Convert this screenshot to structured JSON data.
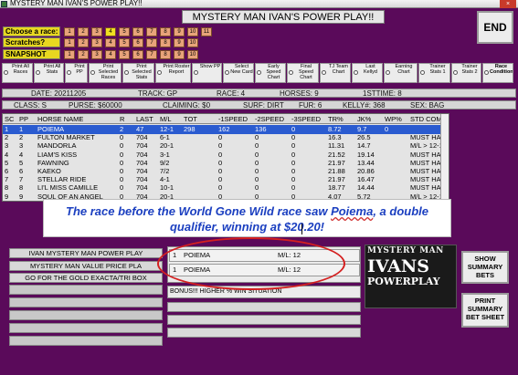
{
  "window": {
    "title": "MYSTERY MAN IVAN'S POWER PLAY!!",
    "close_label": "×"
  },
  "banner": "MYSTERY MAN IVAN'S POWER PLAY!!",
  "end_label": "END",
  "choose_race": {
    "label": "Choose a race:",
    "numbers": [
      "1",
      "2",
      "3",
      "4",
      "5",
      "6",
      "7",
      "8",
      "9",
      "10",
      "11"
    ],
    "selected": "4"
  },
  "scratches": {
    "label": "Scratches?",
    "numbers": [
      "1",
      "2",
      "3",
      "4",
      "5",
      "6",
      "7",
      "8",
      "9",
      "10"
    ]
  },
  "snapshot": {
    "label": "SNAPSHOT",
    "numbers": [
      "1",
      "2",
      "3",
      "4",
      "5",
      "6",
      "7",
      "8",
      "9",
      "10"
    ]
  },
  "options": [
    "Print All Races",
    "Print All Stats",
    "Print PP",
    "Print Selected Races",
    "Print Selected Stats",
    "Print Roster Report",
    "Show PP",
    "Select New Card",
    "Early Speed Chart",
    "Final Speed Chart",
    "TJ Team Chart",
    "Last Kellyd",
    "Earning Chart",
    "Trainer Stats 1",
    "Trainer Stats 2",
    "Race Conditions"
  ],
  "race_info": {
    "date": "DATE: 20211205",
    "track": "TRACK: GP",
    "race": "RACE: 4",
    "horses": "HORSES: 9",
    "istime": "1STTIME: 8"
  },
  "class_info": {
    "class": "CLASS: S",
    "purse": "PURSE: $60000",
    "claiming": "CLAIMING: $0",
    "surf": "SURF: DIRT",
    "fur": "FUR: 6",
    "kelly": "KELLY#: 368",
    "sex": "SEX: BAG"
  },
  "grid": {
    "headers": [
      "SC",
      "PP",
      "HORSE NAME",
      "R",
      "LAST",
      "M/L",
      "TOT",
      "-1SPEED",
      "-2SPEED",
      "-3SPEED",
      "TR%",
      "JK%",
      "WP%",
      "STD COMMENTS"
    ],
    "rows": [
      {
        "sc": "1",
        "pp": "1",
        "name": "POIEMA",
        "r": "2",
        "last": "47",
        "ml": "12-1",
        "tot": "298",
        "s1": "162",
        "s2": "136",
        "s3": "0",
        "tr": "8.72",
        "jk": "9.7",
        "wp": "0",
        "cm": ""
      },
      {
        "sc": "2",
        "pp": "2",
        "name": "FULTON MARKET",
        "r": "0",
        "last": "704",
        "ml": "6-1",
        "tot": "",
        "s1": "0",
        "s2": "0",
        "s3": "0",
        "tr": "16.3",
        "jk": "26.5",
        "wp": "",
        "cm": "MUST HAVE >= 1 PPs..."
      },
      {
        "sc": "3",
        "pp": "3",
        "name": "MANDORLA",
        "r": "0",
        "last": "704",
        "ml": "20-1",
        "tot": "",
        "s1": "0",
        "s2": "0",
        "s3": "0",
        "tr": "11.31",
        "jk": "14.7",
        "wp": "",
        "cm": "M/L > 12-1"
      },
      {
        "sc": "4",
        "pp": "4",
        "name": "LIAM'S KISS",
        "r": "0",
        "last": "704",
        "ml": "3-1",
        "tot": "",
        "s1": "0",
        "s2": "0",
        "s3": "0",
        "tr": "21.52",
        "jk": "19.14",
        "wp": "",
        "cm": "MUST HAVE >= 1 PPs..."
      },
      {
        "sc": "5",
        "pp": "5",
        "name": "FAWNING",
        "r": "0",
        "last": "704",
        "ml": "9/2",
        "tot": "",
        "s1": "0",
        "s2": "0",
        "s3": "0",
        "tr": "21.97",
        "jk": "13.44",
        "wp": "",
        "cm": "MUST HAVE >= 1 PPs..."
      },
      {
        "sc": "6",
        "pp": "6",
        "name": "KAEKO",
        "r": "0",
        "last": "704",
        "ml": "7/2",
        "tot": "",
        "s1": "0",
        "s2": "0",
        "s3": "0",
        "tr": "21.88",
        "jk": "20.86",
        "wp": "",
        "cm": "MUST HAVE >= 1 PPs..."
      },
      {
        "sc": "7",
        "pp": "7",
        "name": "STELLAR RIDE",
        "r": "0",
        "last": "704",
        "ml": "4-1",
        "tot": "",
        "s1": "0",
        "s2": "0",
        "s3": "0",
        "tr": "21.97",
        "jk": "16.47",
        "wp": "",
        "cm": "MUST HAVE >= 1 PPs..."
      },
      {
        "sc": "8",
        "pp": "8",
        "name": "LI'L MISS CAMILLE",
        "r": "0",
        "last": "704",
        "ml": "10-1",
        "tot": "",
        "s1": "0",
        "s2": "0",
        "s3": "0",
        "tr": "18.77",
        "jk": "14.44",
        "wp": "",
        "cm": "MUST HAVE >= 1 PPs..."
      },
      {
        "sc": "9",
        "pp": "9",
        "name": "SOUL OF AN ANGEL",
        "r": "0",
        "last": "704",
        "ml": "20-1",
        "tot": "",
        "s1": "0",
        "s2": "0",
        "s3": "0",
        "tr": "4.07",
        "jk": "5.72",
        "wp": "",
        "cm": "M/L > 12-1"
      }
    ]
  },
  "caption": {
    "line1": "The race before the World Gone Wild race saw ",
    "underlined": "Poiema",
    "line1b": ", a double",
    "line2": "qualifier, winning at $20.20!"
  },
  "left_buttons": [
    "IVAN MYSTERY MAN POWER PLAY",
    "MYSTERY MAN VALUE PRICE PLA",
    "GO FOR THE GOLD EXACTA/TRI BOX"
  ],
  "picks": [
    {
      "pp": "1",
      "name": "POIEMA",
      "ml": "M/L: 12"
    },
    {
      "pp": "1",
      "name": "POIEMA",
      "ml": "M/L: 12"
    }
  ],
  "bonus": "BONUS!!! HIGHER % WIN SITUATION",
  "logo": {
    "line1": "MYSTERY MAN",
    "line2": "IVANS",
    "line3": "POWERPLAY"
  },
  "show_summary": "SHOW SUMMARY BETS",
  "print_summary": "PRINT SUMMARY BET SHEET",
  "colors": {
    "background": "#5a0a5a",
    "selection": "#2a5bd0",
    "label_yellow": "#e8d820",
    "number_button": "#e8a37a",
    "annotation": "#d42020",
    "caption_text": "#1b3fc0"
  }
}
